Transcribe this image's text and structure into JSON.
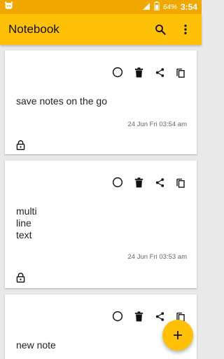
{
  "status_bar": {
    "battery_percent": "64%",
    "time": "3:54"
  },
  "app_bar": {
    "title": "Notebook"
  },
  "notes": [
    {
      "text": "save notes on the go",
      "date": "24 Jun Fri 03:54 am"
    },
    {
      "text": "multi\nline\ntext",
      "date": "24 Jun Fri 03:53 am"
    },
    {
      "text": "new note",
      "date": ""
    }
  ],
  "colors": {
    "accent": "#ffc107",
    "status_bar": "#f0a800"
  }
}
